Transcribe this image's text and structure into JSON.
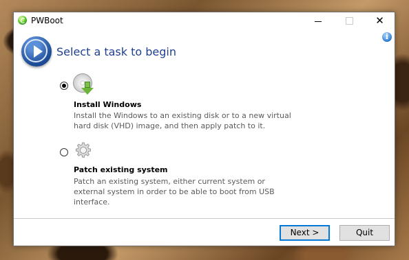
{
  "window": {
    "title": "PWBoot",
    "controls": {
      "minimize": "—",
      "maximize": "☐",
      "close": "✕"
    }
  },
  "header": {
    "heading": "Select a task to begin",
    "info_icon": "i"
  },
  "options": [
    {
      "title": "Install Windows",
      "description": "Install the Windows to an existing disk or to a new virtual hard disk (VHD) image, and then apply patch to it.",
      "selected": true,
      "icon": "disc-download-icon"
    },
    {
      "title": "Patch existing system",
      "description": "Patch an existing system, either current system or external system in order to be able to boot from USB interface.",
      "selected": false,
      "icon": "gear-icon"
    }
  ],
  "buttons": {
    "next": "Next >",
    "quit": "Quit"
  },
  "colors": {
    "heading": "#1f3f8f",
    "accent": "#0078d7"
  }
}
